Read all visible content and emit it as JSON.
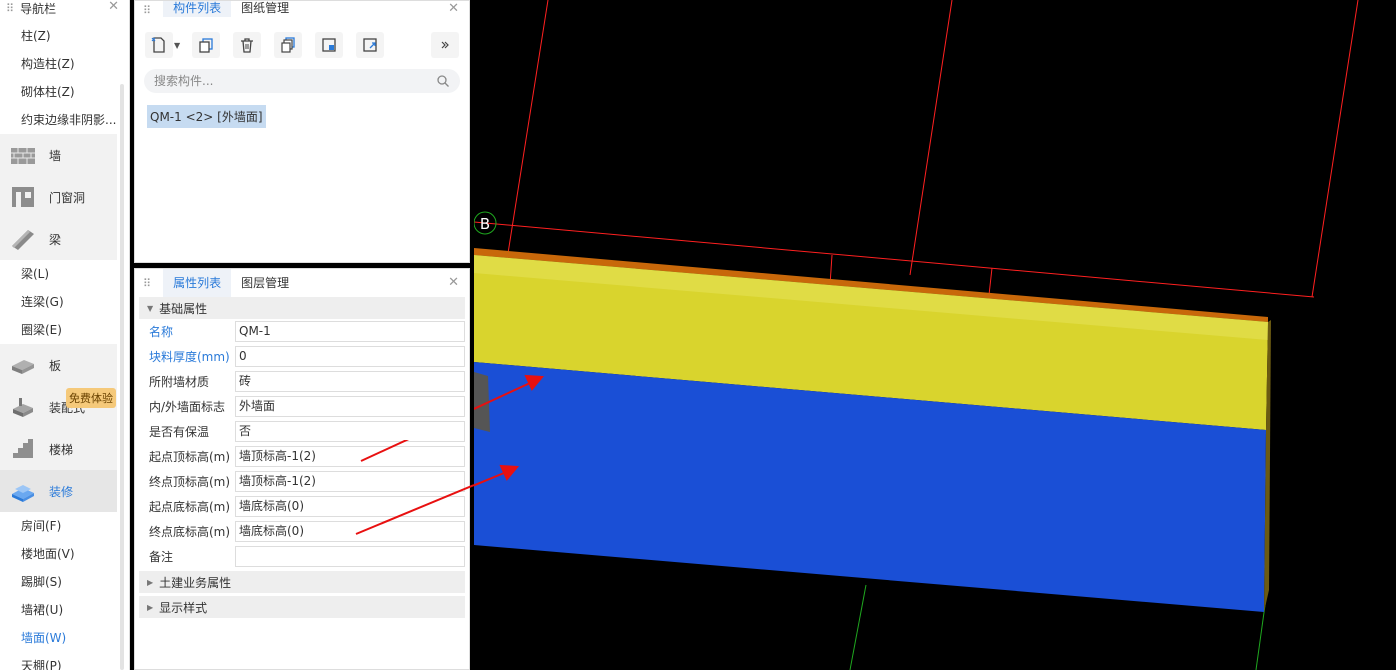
{
  "nav": {
    "title": "导航栏",
    "top_items": [
      "柱(Z)",
      "构造柱(Z)",
      "砌体柱(Z)",
      "约束边缘非阴影..."
    ],
    "categories": {
      "wall": "墙",
      "opening": "门窗洞",
      "beam": "梁",
      "slab": "板",
      "prefab": "装配式",
      "stairs": "楼梯",
      "finish": "装修"
    },
    "beam_items": [
      "梁(L)",
      "连梁(G)",
      "圈梁(E)"
    ],
    "finish_items": [
      "房间(F)",
      "楼地面(V)",
      "踢脚(S)",
      "墙裙(U)",
      "墙面(W)",
      "天棚(P)"
    ],
    "badge": "免费体验"
  },
  "component_panel": {
    "tabs": [
      "构件列表",
      "图纸管理"
    ],
    "search_placeholder": "搜索构件...",
    "item": "QM-1 <2> [外墙面]"
  },
  "property_panel": {
    "tabs": [
      "属性列表",
      "图层管理"
    ],
    "groups": {
      "basic": "基础属性",
      "civil": "土建业务属性",
      "display": "显示样式"
    },
    "rows": [
      {
        "label": "名称",
        "value": "QM-1"
      },
      {
        "label": "块料厚度(mm)",
        "value": "0"
      },
      {
        "label": "所附墙材质",
        "value": "砖"
      },
      {
        "label": "内/外墙面标志",
        "value": "外墙面"
      },
      {
        "label": "是否有保温",
        "value": "否"
      },
      {
        "label": "起点顶标高(m)",
        "value": "墙顶标高-1(2)"
      },
      {
        "label": "终点顶标高(m)",
        "value": "墙顶标高-1(2)"
      },
      {
        "label": "起点底标高(m)",
        "value": "墙底标高(0)"
      },
      {
        "label": "终点底标高(m)",
        "value": "墙底标高(0)"
      },
      {
        "label": "备注",
        "value": ""
      }
    ]
  },
  "viewport": {
    "axis_label": "B",
    "colors": {
      "yellow": "#d9d42d",
      "blue": "#1a4fd6",
      "orange": "#c8680a",
      "grid": "#ff2020",
      "arrow": "#e81010"
    }
  }
}
